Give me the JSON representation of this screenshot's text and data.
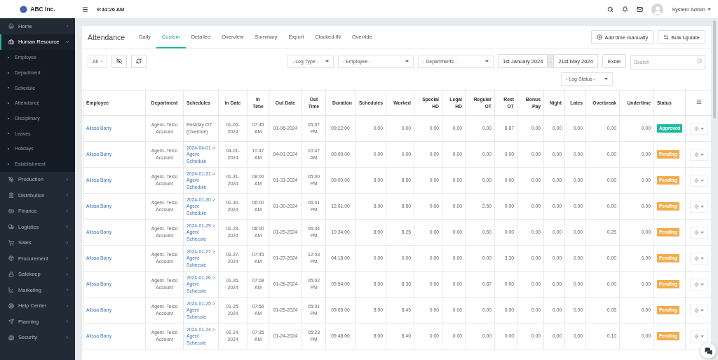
{
  "brand": {
    "name": "ABC Inc."
  },
  "sidebar": {
    "items": [
      {
        "label": "Home",
        "expanded": false
      },
      {
        "label": "Human Resource",
        "expanded": true,
        "children": [
          {
            "label": "Employee"
          },
          {
            "label": "Department"
          },
          {
            "label": "Schedule"
          },
          {
            "label": "Attendance"
          },
          {
            "label": "Disciplinary"
          },
          {
            "label": "Leaves"
          },
          {
            "label": "Holidays"
          },
          {
            "label": "Establishment"
          }
        ]
      },
      {
        "label": "Production",
        "expanded": false
      },
      {
        "label": "Distribution",
        "expanded": false
      },
      {
        "label": "Finance",
        "expanded": false
      },
      {
        "label": "Logistics",
        "expanded": false
      },
      {
        "label": "Sales",
        "expanded": false
      },
      {
        "label": "Procurement",
        "expanded": false
      },
      {
        "label": "Safekeep",
        "expanded": false
      },
      {
        "label": "Marketing",
        "expanded": false
      },
      {
        "label": "Help Center",
        "expanded": false
      },
      {
        "label": "Planning",
        "expanded": false
      },
      {
        "label": "Security",
        "expanded": false
      }
    ]
  },
  "header": {
    "time": "9:44:26 AM",
    "user": "System Admin"
  },
  "page": {
    "title": "Attendance",
    "tabs": [
      {
        "label": "Daily",
        "selected": false
      },
      {
        "label": "Custom",
        "selected": true
      },
      {
        "label": "Detailed",
        "selected": false
      },
      {
        "label": "Overview",
        "selected": false
      },
      {
        "label": "Summary",
        "selected": false
      },
      {
        "label": "Export",
        "selected": false
      },
      {
        "label": "Clocked IN",
        "selected": false
      },
      {
        "label": "Override",
        "selected": false
      }
    ],
    "actions": [
      "Add time manually",
      "Bulk Update"
    ]
  },
  "filters": {
    "show": "All",
    "log_type": "- Log Type -",
    "employee": "- Employee -",
    "departments": "- Departments -",
    "date_from": "1st January 2024",
    "date_separator": "-",
    "date_to": "21st May 2024",
    "export": "Excel",
    "search_placeholder": "Search",
    "log_status": "- Log Status -"
  },
  "table": {
    "columns": [
      "Employee",
      "Department",
      "Schedules",
      "In Date",
      "In Time",
      "Out Date",
      "Out Time",
      "Duration",
      "Schedules",
      "Worked",
      "Special HD",
      "Legal HD",
      "Regular OT",
      "Rest OT",
      "Bonus Pay",
      "Night",
      "Lates",
      "Overbreak",
      "Undertime",
      "Status"
    ],
    "rows": [
      {
        "employee": "Alissa Barry",
        "department": "Agent- Telco Account",
        "schedule": {
          "kind": "override",
          "text": "Restday OT (Override)"
        },
        "in_date": "01-06-2024",
        "in_time": "07:45 AM",
        "out_date": "01-06-2024",
        "out_time": "05:07 PM",
        "duration": "09:22:00",
        "values": [
          "0.00",
          "0.00",
          "0.00",
          "0.00",
          "0.00",
          "8.87",
          "0.00",
          "0.00",
          "0.00",
          "0.00",
          "0.00"
        ],
        "status": {
          "label": "Approved",
          "kind": "approved"
        }
      },
      {
        "employee": "Alissa Barry",
        "department": "Agent- Telco Account",
        "schedule": {
          "kind": "link",
          "text": "2024-04-01 > Agent Schedule"
        },
        "in_date": "04-01-2024",
        "in_time": "10:47 AM",
        "out_date": "04-01-2024",
        "out_time": "10:47 AM",
        "duration": "00:00:00",
        "values": [
          "0.00",
          "0.00",
          "0.00",
          "0.00",
          "0.00",
          "0.00",
          "0.00",
          "0.00",
          "0.00",
          "0.00",
          "0.00"
        ],
        "status": {
          "label": "Pending",
          "kind": "pending"
        }
      },
      {
        "employee": "Alissa Barry",
        "department": "Agent- Telco Account",
        "schedule": {
          "kind": "link",
          "text": "2024-01-31 > Agent Schedule"
        },
        "in_date": "01-31-2024",
        "in_time": "08:00 AM",
        "out_date": "01-31-2024",
        "out_time": "05:00 PM",
        "duration": "09:00:00",
        "values": [
          "8.00",
          "8.50",
          "0.00",
          "0.00",
          "0.00",
          "0.00",
          "0.00",
          "0.00",
          "0.00",
          "0.00",
          "0.00"
        ],
        "status": {
          "label": "Pending",
          "kind": "pending"
        }
      },
      {
        "employee": "Alissa Barry",
        "department": "Agent- Telco Account",
        "schedule": {
          "kind": "link",
          "text": "2024-01-30 > Agent Schedule"
        },
        "in_date": "01-30-2024",
        "in_time": "06:00 AM",
        "out_date": "01-30-2024",
        "out_time": "06:01 PM",
        "duration": "12:01:00",
        "values": [
          "8.00",
          "8.50",
          "0.00",
          "0.00",
          "2.50",
          "0.00",
          "0.00",
          "0.00",
          "0.00",
          "0.00",
          "0.00"
        ],
        "status": {
          "label": "Pending",
          "kind": "pending"
        }
      },
      {
        "employee": "Alissa Barry",
        "department": "Agent- Telco Account",
        "schedule": {
          "kind": "link",
          "text": "2024-01-29 > Agent Schecule"
        },
        "in_date": "01-29-2024",
        "in_time": "08:00 AM",
        "out_date": "01-29-2024",
        "out_time": "06:34 PM",
        "duration": "10:34:00",
        "values": [
          "8.00",
          "8.25",
          "0.00",
          "0.00",
          "0.50",
          "0.00",
          "0.00",
          "0.00",
          "0.00",
          "0.25",
          "0.00"
        ],
        "status": {
          "label": "Pending",
          "kind": "pending"
        }
      },
      {
        "employee": "Alissa Barry",
        "department": "Agent- Telco Account",
        "schedule": {
          "kind": "link",
          "text": "2024-01-27 > Agent Schecule"
        },
        "in_date": "01-27-2024",
        "in_time": "07:45 AM",
        "out_date": "01-27-2024",
        "out_time": "12:03 PM",
        "duration": "04:18:00",
        "values": [
          "0.00",
          "0.00",
          "0.00",
          "0.00",
          "0.00",
          "3.30",
          "0.00",
          "0.00",
          "0.00",
          "0.00",
          "0.00"
        ],
        "status": {
          "label": "Pending",
          "kind": "pending"
        }
      },
      {
        "employee": "Alissa Barry",
        "department": "Agent- Telco Account",
        "schedule": {
          "kind": "link",
          "text": "2024-01-26 > Agent Schecule"
        },
        "in_date": "01-26-2024",
        "in_time": "07:08 AM",
        "out_date": "01-26-2024",
        "out_time": "05:02 PM",
        "duration": "09:54:00",
        "values": [
          "8.00",
          "8.30",
          "0.00",
          "0.00",
          "0.87",
          "0.00",
          "0.00",
          "0.00",
          "0.00",
          "0.00",
          "0.00"
        ],
        "status": {
          "label": "Pending",
          "kind": "pending"
        }
      },
      {
        "employee": "Alissa Barry",
        "department": "Agent- Telco Account",
        "schedule": {
          "kind": "link",
          "text": "2024-01-25 > Agent Schecule"
        },
        "in_date": "01-25-2024",
        "in_time": "07:56 AM",
        "out_date": "01-25-2024",
        "out_time": "05:01 PM",
        "duration": "09:05:00",
        "values": [
          "8.00",
          "8.45",
          "0.00",
          "0.00",
          "0.00",
          "0.00",
          "0.00",
          "0.00",
          "0.00",
          "0.05",
          "0.00"
        ],
        "status": {
          "label": "Pending",
          "kind": "pending"
        }
      },
      {
        "employee": "Alissa Barry",
        "department": "Agent- Telco Account",
        "schedule": {
          "kind": "link",
          "text": "2024-01-24 > Agent Schecule"
        },
        "in_date": "01-24-2024",
        "in_time": "07:35 AM",
        "out_date": "01-24-2024",
        "out_time": "05:23 PM",
        "duration": "09:48:00",
        "values": [
          "8.00",
          "8.40",
          "0.00",
          "0.00",
          "0.00",
          "0.00",
          "0.00",
          "0.00",
          "0.00",
          "0.10",
          "0.00"
        ],
        "status": {
          "label": "Pending",
          "kind": "pending"
        }
      }
    ]
  }
}
